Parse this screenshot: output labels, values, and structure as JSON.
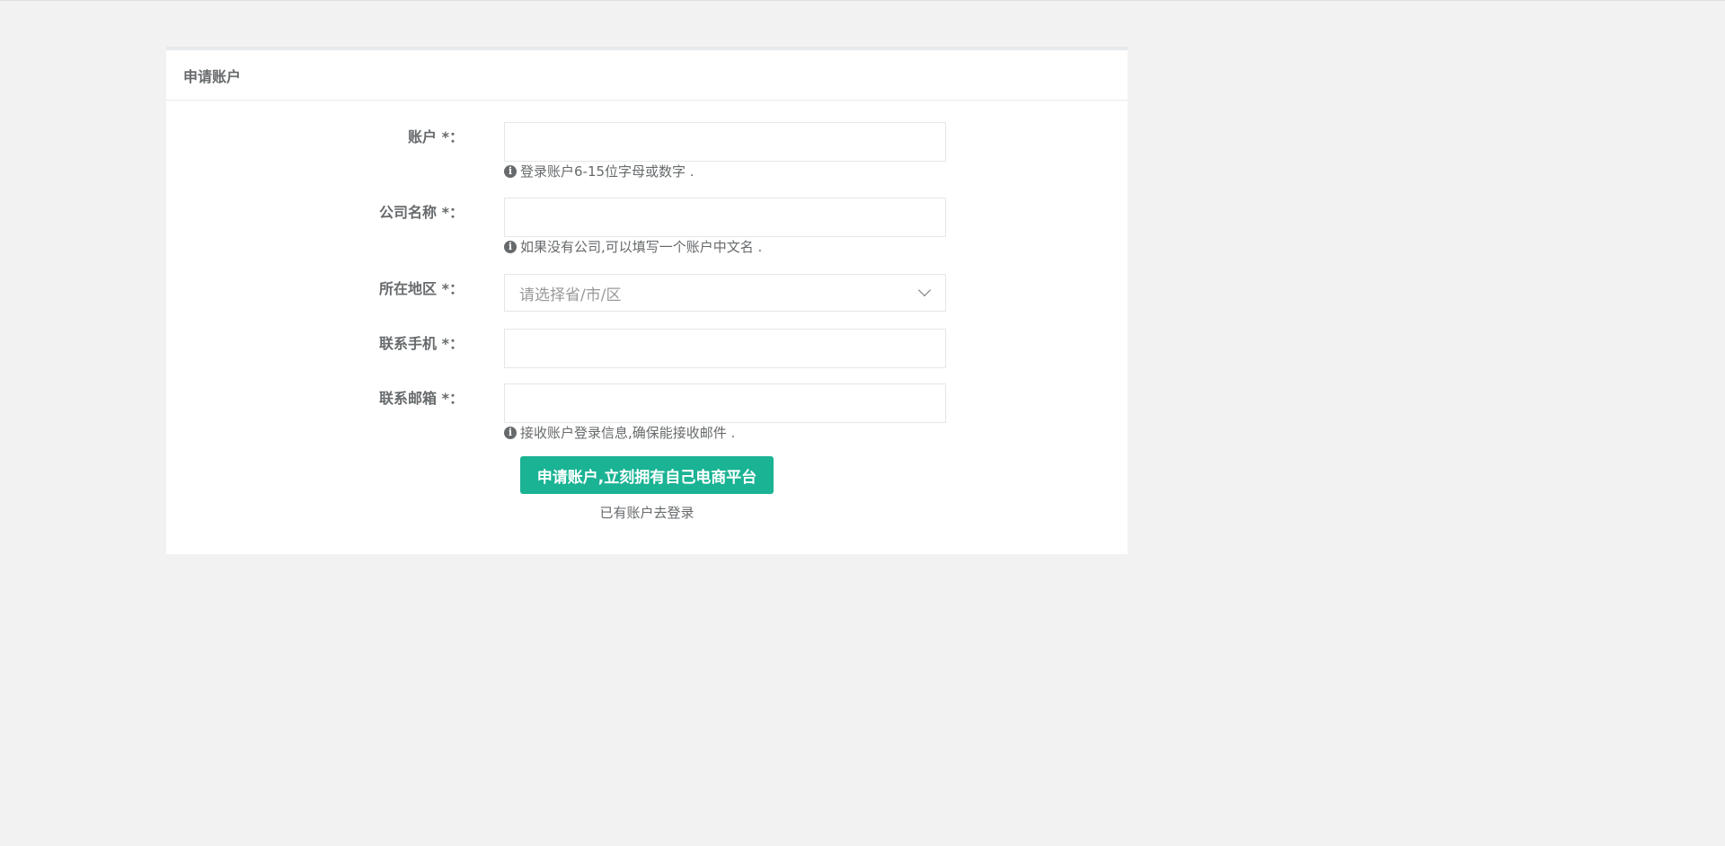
{
  "panel": {
    "title": "申请账户"
  },
  "form": {
    "account": {
      "label": "账户",
      "required_mark": "*：",
      "value": "",
      "help": "登录账户6-15位字母或数字 ."
    },
    "company": {
      "label": "公司名称",
      "required_mark": "*：",
      "value": "",
      "help": "如果没有公司,可以填写一个账户中文名 ."
    },
    "region": {
      "label": "所在地区",
      "required_mark": "*：",
      "placeholder": "请选择省/市/区"
    },
    "phone": {
      "label": "联系手机",
      "required_mark": "*：",
      "value": ""
    },
    "email": {
      "label": "联系邮箱",
      "required_mark": "*：",
      "value": "",
      "help": "接收账户登录信息,确保能接收邮件 ."
    },
    "submit_label": "申请账户,立刻拥有自己电商平台",
    "login_link": "已有账户去登录"
  },
  "colors": {
    "primary": "#1ab394",
    "background": "#f2f2f2",
    "text": "#676a6c"
  }
}
